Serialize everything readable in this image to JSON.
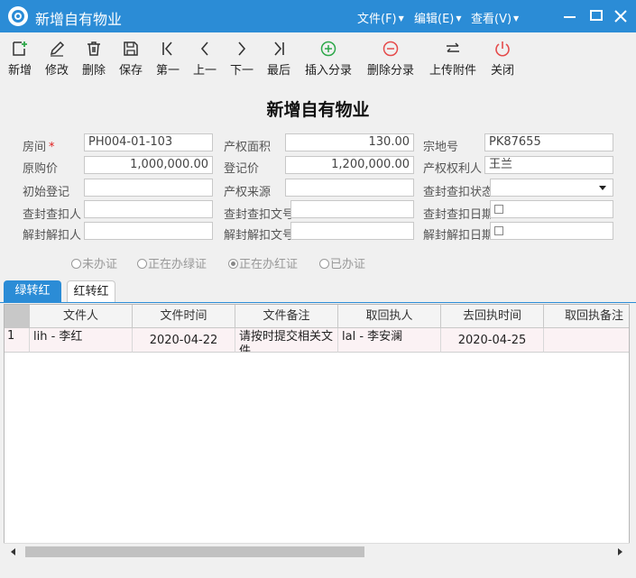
{
  "window": {
    "title": "新增自有物业",
    "menus": [
      "文件(F)",
      "编辑(E)",
      "查看(V)"
    ]
  },
  "toolbar": {
    "buttons": [
      {
        "icon": "add-document-icon",
        "label": "新增"
      },
      {
        "icon": "edit-icon",
        "label": "修改"
      },
      {
        "icon": "trash-icon",
        "label": "删除"
      },
      {
        "icon": "save-icon",
        "label": "保存"
      },
      {
        "icon": "first-icon",
        "label": "第一"
      },
      {
        "icon": "previous-icon",
        "label": "上一"
      },
      {
        "icon": "next-icon",
        "label": "下一"
      },
      {
        "icon": "last-icon",
        "label": "最后"
      },
      {
        "icon": "insert-plus-icon",
        "label": "插入分录"
      },
      {
        "icon": "delete-minus-icon",
        "label": "删除分录"
      },
      {
        "icon": "upload-exchange-icon",
        "label": "上传附件"
      },
      {
        "icon": "power-icon",
        "label": "关闭"
      }
    ],
    "colors": {
      "insert": "#2ea84a",
      "delete": "#e54b4b",
      "close": "#e54b4b"
    }
  },
  "form": {
    "title": "新增自有物业",
    "fields": {
      "room": {
        "label": "房间",
        "value": "PH004-01-103",
        "required": true
      },
      "area": {
        "label": "产权面积",
        "value": "130.00"
      },
      "lot": {
        "label": "宗地号",
        "value": "PK87655"
      },
      "original_price": {
        "label": "原购价",
        "value": "1,000,000.00"
      },
      "registered_price": {
        "label": "登记价",
        "value": "1,200,000.00"
      },
      "owner": {
        "label": "产权权利人",
        "value": "王兰"
      },
      "initial_registration": {
        "label": "初始登记",
        "value": ""
      },
      "property_source": {
        "label": "产权来源",
        "value": ""
      },
      "seizure_status": {
        "label": "查封查扣状态",
        "value": ""
      },
      "seizure_person": {
        "label": "查封查扣人",
        "value": ""
      },
      "seizure_doc": {
        "label": "查封查扣文号",
        "value": ""
      },
      "seizure_date": {
        "label": "查封查扣日期",
        "value": ""
      },
      "release_person": {
        "label": "解封解扣人",
        "value": ""
      },
      "release_doc": {
        "label": "解封解扣文号",
        "value": ""
      },
      "release_date": {
        "label": "解封解扣日期",
        "value": ""
      }
    },
    "status_options": [
      {
        "label": "未办证",
        "selected": false
      },
      {
        "label": "正在办绿证",
        "selected": false
      },
      {
        "label": "正在办红证",
        "selected": true
      },
      {
        "label": "已办证",
        "selected": false
      }
    ]
  },
  "tabs": [
    {
      "label": "绿转红",
      "active": true
    },
    {
      "label": "红转红",
      "active": false
    }
  ],
  "grid": {
    "columns": [
      "文件人",
      "文件时间",
      "文件备注",
      "取回执人",
      "去回执时间",
      "取回执备注"
    ],
    "rows": [
      {
        "num": "1",
        "cells": [
          "lih - 李红",
          "2020-04-22",
          "请按时提交相关文件",
          "lal - 李安澜",
          "2020-04-25",
          ""
        ]
      }
    ]
  },
  "colors": {
    "titlebar": "#2b8cd6",
    "row_highlight": "#fbf2f4"
  }
}
